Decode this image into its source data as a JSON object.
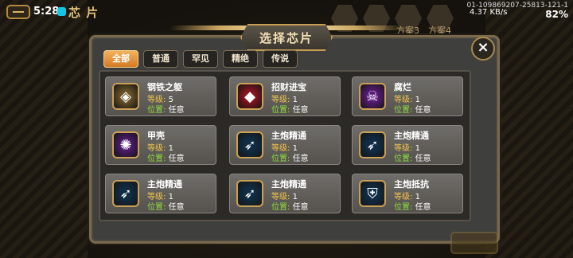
{
  "status": {
    "time": "5:28",
    "page_tag": "芯 片",
    "net_speed": "4.37 KB/s",
    "device_id": "01-109869207-25813-121-1",
    "battery": "82%"
  },
  "top_slots": [
    {
      "label": ""
    },
    {
      "label": ""
    },
    {
      "label": "方案3"
    },
    {
      "label": "方案4"
    }
  ],
  "modal": {
    "title": "选择芯片",
    "close_glyph": "×"
  },
  "tabs": [
    {
      "label": "全部",
      "active": true
    },
    {
      "label": "普通",
      "active": false
    },
    {
      "label": "罕见",
      "active": false
    },
    {
      "label": "精绝",
      "active": false
    },
    {
      "label": "传说",
      "active": false
    }
  ],
  "chips": [
    {
      "name": "钢铁之躯",
      "level_label": "等级:",
      "level": "5",
      "pos_label": "位置:",
      "pos": "任意",
      "icon": "steel-body-icon",
      "color": "#6b5427",
      "glyph": "◈"
    },
    {
      "name": "招财进宝",
      "level_label": "等级:",
      "level": "1",
      "pos_label": "位置:",
      "pos": "任意",
      "icon": "fortune-gem-icon",
      "color": "#8a1420",
      "glyph": "◆"
    },
    {
      "name": "腐烂",
      "level_label": "等级:",
      "level": "1",
      "pos_label": "位置:",
      "pos": "任意",
      "icon": "rot-skull-icon",
      "color": "#5a1a7a",
      "glyph": "☠"
    },
    {
      "name": "甲壳",
      "level_label": "等级:",
      "level": "1",
      "pos_label": "位置:",
      "pos": "任意",
      "icon": "beetle-shell-icon",
      "color": "#4e1a6e",
      "glyph": "✺"
    },
    {
      "name": "主炮精通",
      "level_label": "等级:",
      "level": "1",
      "pos_label": "位置:",
      "pos": "任意",
      "icon": "cannon-shell-icon",
      "color": "#0f2d45",
      "glyph": "➶"
    },
    {
      "name": "主炮精通",
      "level_label": "等级:",
      "level": "1",
      "pos_label": "位置:",
      "pos": "任意",
      "icon": "cannon-shell-icon",
      "color": "#0f2d45",
      "glyph": "➶"
    },
    {
      "name": "主炮精通",
      "level_label": "等级:",
      "level": "1",
      "pos_label": "位置:",
      "pos": "任意",
      "icon": "cannon-shell-icon",
      "color": "#0f2d45",
      "glyph": "➶"
    },
    {
      "name": "主炮精通",
      "level_label": "等级:",
      "level": "1",
      "pos_label": "位置:",
      "pos": "任意",
      "icon": "cannon-shell-icon",
      "color": "#0f2d45",
      "glyph": "➶"
    },
    {
      "name": "主炮抵抗",
      "level_label": "等级:",
      "level": "1",
      "pos_label": "位置:",
      "pos": "任意",
      "icon": "shield-icon",
      "color": "#0f2d45",
      "glyph": "⛨"
    }
  ]
}
